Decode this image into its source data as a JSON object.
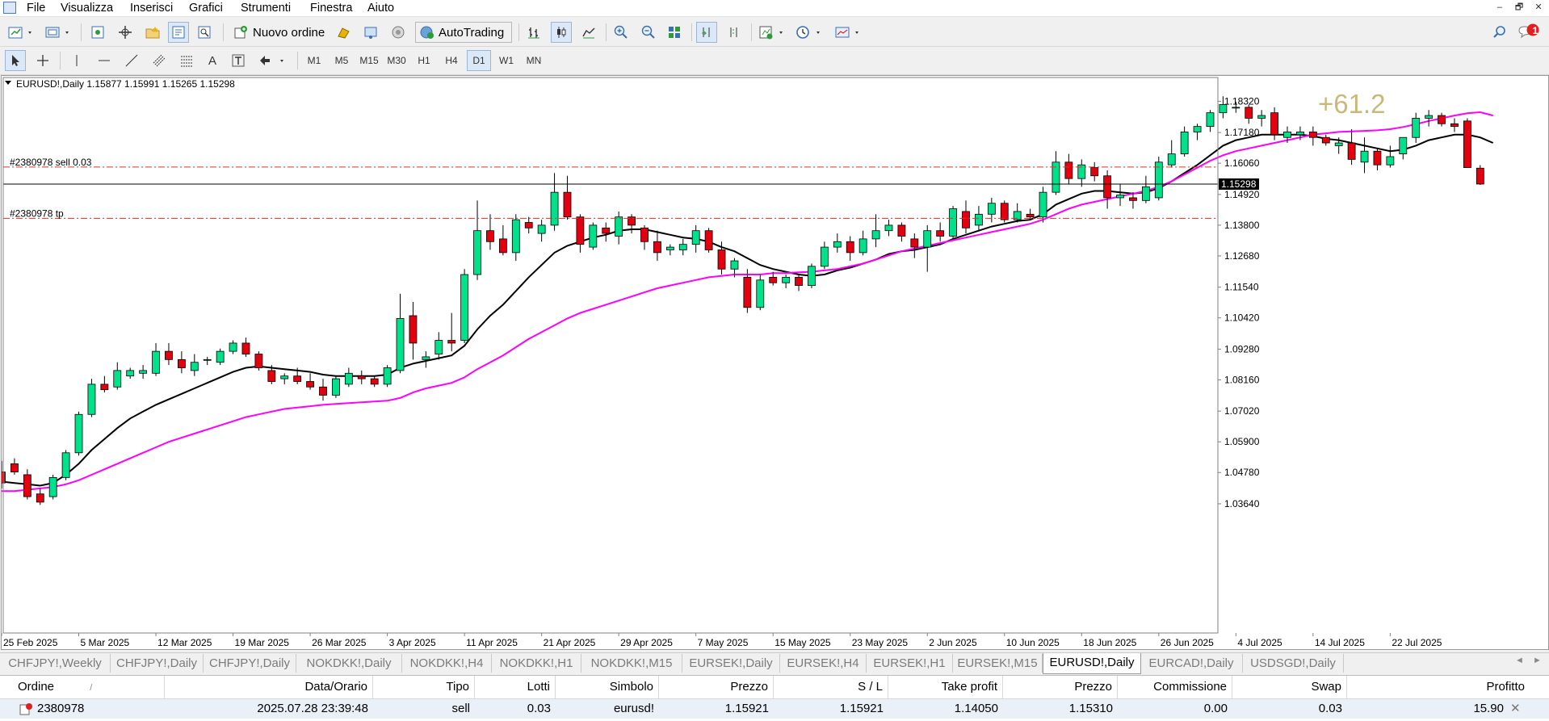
{
  "menu": [
    "File",
    "Visualizza",
    "Inserisci",
    "Grafici",
    "Strumenti",
    "Finestra",
    "Aiuto"
  ],
  "window_controls": [
    "–",
    "🗗",
    "✕"
  ],
  "toolbar": {
    "new_order_label": "Nuovo ordine",
    "autotrading_label": "AutoTrading",
    "notification_count": "1"
  },
  "timeframes": [
    "M1",
    "M5",
    "M15",
    "M30",
    "H1",
    "H4",
    "D1",
    "W1",
    "MN"
  ],
  "active_timeframe": "D1",
  "chart_header": "EURUSD!,Daily  1.15877 1.15991 1.15265 1.15298",
  "order_line_labels": {
    "sell": "#2380978 sell 0.03",
    "tp": "#2380978 tp"
  },
  "profit_overlay": "+61.2",
  "current_price_label": "1.15298",
  "chart_data": {
    "type": "candlestick",
    "symbol": "EURUSD!",
    "timeframe": "Daily",
    "ylim": [
      1.0305,
      1.1895
    ],
    "y_ticks": [
      "1.18320",
      "1.17180",
      "1.16060",
      "1.14920",
      "1.13800",
      "1.12680",
      "1.11540",
      "1.10420",
      "1.09280",
      "1.08160",
      "1.07020",
      "1.05900",
      "1.04780",
      "1.03640"
    ],
    "x_tick_labels": [
      "25 Feb 2025",
      "5 Mar 2025",
      "12 Mar 2025",
      "19 Mar 2025",
      "26 Mar 2025",
      "3 Apr 2025",
      "11 Apr 2025",
      "21 Apr 2025",
      "29 Apr 2025",
      "7 May 2025",
      "15 May 2025",
      "23 May 2025",
      "2 Jun 2025",
      "10 Jun 2025",
      "18 Jun 2025",
      "26 Jun 2025",
      "4 Jul 2025",
      "14 Jul 2025",
      "22 Jul 2025"
    ],
    "x_tick_index": [
      0,
      6,
      12,
      18,
      24,
      30,
      36,
      42,
      48,
      54,
      60,
      66,
      72,
      78,
      84,
      90,
      96,
      102,
      108
    ],
    "horizontal_lines": [
      {
        "name": "sell-entry",
        "price": 1.15921,
        "style": "dash-dot",
        "color": "#e0302a"
      },
      {
        "name": "take-profit",
        "price": 1.1405,
        "style": "dash-dot",
        "color": "#e0302a"
      },
      {
        "name": "current-bid",
        "price": 1.15298,
        "style": "solid",
        "color": "#000000"
      }
    ],
    "candles_ohlc": [
      [
        1.048,
        1.052,
        1.042,
        1.044
      ],
      [
        1.051,
        1.053,
        1.047,
        1.048
      ],
      [
        1.047,
        1.049,
        1.038,
        1.039
      ],
      [
        1.04,
        1.042,
        1.036,
        1.037
      ],
      [
        1.039,
        1.047,
        1.038,
        1.046
      ],
      [
        1.046,
        1.056,
        1.045,
        1.055
      ],
      [
        1.055,
        1.07,
        1.054,
        1.069
      ],
      [
        1.069,
        1.082,
        1.068,
        1.08
      ],
      [
        1.08,
        1.083,
        1.077,
        1.078
      ],
      [
        1.079,
        1.088,
        1.078,
        1.085
      ],
      [
        1.083,
        1.086,
        1.082,
        1.085
      ],
      [
        1.084,
        1.087,
        1.082,
        1.085
      ],
      [
        1.084,
        1.095,
        1.083,
        1.092
      ],
      [
        1.092,
        1.095,
        1.087,
        1.089
      ],
      [
        1.089,
        1.092,
        1.084,
        1.086
      ],
      [
        1.085,
        1.091,
        1.083,
        1.088
      ],
      [
        1.089,
        1.09,
        1.087,
        1.089
      ],
      [
        1.088,
        1.093,
        1.087,
        1.092
      ],
      [
        1.092,
        1.096,
        1.091,
        1.095
      ],
      [
        1.095,
        1.097,
        1.09,
        1.091
      ],
      [
        1.091,
        1.092,
        1.085,
        1.086
      ],
      [
        1.085,
        1.087,
        1.08,
        1.081
      ],
      [
        1.082,
        1.084,
        1.08,
        1.083
      ],
      [
        1.083,
        1.086,
        1.08,
        1.081
      ],
      [
        1.081,
        1.084,
        1.078,
        1.079
      ],
      [
        1.079,
        1.082,
        1.074,
        1.076
      ],
      [
        1.076,
        1.083,
        1.075,
        1.082
      ],
      [
        1.08,
        1.086,
        1.079,
        1.084
      ],
      [
        1.083,
        1.085,
        1.08,
        1.082
      ],
      [
        1.082,
        1.083,
        1.079,
        1.08
      ],
      [
        1.08,
        1.087,
        1.079,
        1.086
      ],
      [
        1.085,
        1.113,
        1.084,
        1.104
      ],
      [
        1.105,
        1.11,
        1.089,
        1.095
      ],
      [
        1.089,
        1.092,
        1.086,
        1.09
      ],
      [
        1.091,
        1.099,
        1.089,
        1.096
      ],
      [
        1.096,
        1.106,
        1.092,
        1.095
      ],
      [
        1.096,
        1.122,
        1.095,
        1.12
      ],
      [
        1.12,
        1.147,
        1.118,
        1.136
      ],
      [
        1.136,
        1.142,
        1.129,
        1.132
      ],
      [
        1.133,
        1.138,
        1.127,
        1.128
      ],
      [
        1.128,
        1.142,
        1.125,
        1.14
      ],
      [
        1.139,
        1.141,
        1.135,
        1.137
      ],
      [
        1.135,
        1.14,
        1.132,
        1.138
      ],
      [
        1.138,
        1.157,
        1.136,
        1.15
      ],
      [
        1.15,
        1.156,
        1.14,
        1.141
      ],
      [
        1.141,
        1.142,
        1.128,
        1.131
      ],
      [
        1.13,
        1.139,
        1.129,
        1.138
      ],
      [
        1.137,
        1.139,
        1.132,
        1.135
      ],
      [
        1.134,
        1.143,
        1.131,
        1.141
      ],
      [
        1.141,
        1.142,
        1.135,
        1.138
      ],
      [
        1.137,
        1.138,
        1.129,
        1.132
      ],
      [
        1.132,
        1.136,
        1.125,
        1.128
      ],
      [
        1.129,
        1.131,
        1.127,
        1.13
      ],
      [
        1.129,
        1.133,
        1.127,
        1.131
      ],
      [
        1.131,
        1.138,
        1.128,
        1.136
      ],
      [
        1.136,
        1.137,
        1.128,
        1.129
      ],
      [
        1.129,
        1.132,
        1.12,
        1.122
      ],
      [
        1.122,
        1.126,
        1.119,
        1.125
      ],
      [
        1.119,
        1.122,
        1.106,
        1.108
      ],
      [
        1.108,
        1.12,
        1.107,
        1.118
      ],
      [
        1.119,
        1.121,
        1.116,
        1.117
      ],
      [
        1.117,
        1.12,
        1.115,
        1.119
      ],
      [
        1.119,
        1.12,
        1.114,
        1.116
      ],
      [
        1.116,
        1.124,
        1.115,
        1.123
      ],
      [
        1.123,
        1.132,
        1.122,
        1.13
      ],
      [
        1.13,
        1.135,
        1.128,
        1.132
      ],
      [
        1.132,
        1.134,
        1.125,
        1.128
      ],
      [
        1.128,
        1.136,
        1.127,
        1.133
      ],
      [
        1.133,
        1.142,
        1.13,
        1.136
      ],
      [
        1.136,
        1.14,
        1.134,
        1.138
      ],
      [
        1.138,
        1.139,
        1.132,
        1.134
      ],
      [
        1.133,
        1.135,
        1.126,
        1.13
      ],
      [
        1.13,
        1.138,
        1.121,
        1.136
      ],
      [
        1.136,
        1.139,
        1.132,
        1.134
      ],
      [
        1.134,
        1.145,
        1.133,
        1.144
      ],
      [
        1.143,
        1.147,
        1.135,
        1.137
      ],
      [
        1.138,
        1.145,
        1.136,
        1.142
      ],
      [
        1.142,
        1.148,
        1.139,
        1.146
      ],
      [
        1.146,
        1.147,
        1.139,
        1.14
      ],
      [
        1.14,
        1.146,
        1.139,
        1.143
      ],
      [
        1.142,
        1.144,
        1.14,
        1.141
      ],
      [
        1.141,
        1.152,
        1.139,
        1.15
      ],
      [
        1.15,
        1.165,
        1.149,
        1.161
      ],
      [
        1.161,
        1.164,
        1.153,
        1.155
      ],
      [
        1.155,
        1.162,
        1.152,
        1.16
      ],
      [
        1.159,
        1.161,
        1.154,
        1.156
      ],
      [
        1.156,
        1.158,
        1.144,
        1.148
      ],
      [
        1.148,
        1.153,
        1.145,
        1.149
      ],
      [
        1.148,
        1.15,
        1.144,
        1.147
      ],
      [
        1.147,
        1.156,
        1.146,
        1.152
      ],
      [
        1.148,
        1.163,
        1.147,
        1.161
      ],
      [
        1.16,
        1.169,
        1.159,
        1.164
      ],
      [
        1.164,
        1.174,
        1.163,
        1.172
      ],
      [
        1.172,
        1.175,
        1.169,
        1.174
      ],
      [
        1.174,
        1.18,
        1.172,
        1.179
      ],
      [
        1.179,
        1.185,
        1.177,
        1.182
      ],
      [
        1.181,
        1.183,
        1.179,
        1.181
      ],
      [
        1.181,
        1.182,
        1.175,
        1.177
      ],
      [
        1.177,
        1.18,
        1.174,
        1.178
      ],
      [
        1.179,
        1.181,
        1.169,
        1.171
      ],
      [
        1.17,
        1.174,
        1.168,
        1.172
      ],
      [
        1.171,
        1.174,
        1.169,
        1.172
      ],
      [
        1.172,
        1.174,
        1.167,
        1.17
      ],
      [
        1.17,
        1.171,
        1.167,
        1.168
      ],
      [
        1.167,
        1.17,
        1.164,
        1.168
      ],
      [
        1.168,
        1.173,
        1.16,
        1.162
      ],
      [
        1.161,
        1.17,
        1.157,
        1.165
      ],
      [
        1.165,
        1.166,
        1.158,
        1.16
      ],
      [
        1.16,
        1.167,
        1.159,
        1.163
      ],
      [
        1.164,
        1.17,
        1.162,
        1.17
      ],
      [
        1.17,
        1.179,
        1.168,
        1.177
      ],
      [
        1.177,
        1.18,
        1.174,
        1.178
      ],
      [
        1.178,
        1.179,
        1.174,
        1.175
      ],
      [
        1.175,
        1.177,
        1.172,
        1.174
      ],
      [
        1.176,
        1.177,
        1.159,
        1.159
      ],
      [
        1.1588,
        1.1599,
        1.1527,
        1.153
      ]
    ],
    "series": [
      {
        "kind": "moving-average",
        "color": "#000000",
        "values": [
          1.0445,
          1.044,
          1.0435,
          1.043,
          1.044,
          1.047,
          1.051,
          1.056,
          1.06,
          1.064,
          1.0675,
          1.07,
          1.0725,
          1.0745,
          1.0765,
          1.0785,
          1.0805,
          1.0825,
          1.0845,
          1.086,
          1.0865,
          1.086,
          1.0855,
          1.085,
          1.0845,
          1.0835,
          1.083,
          1.083,
          1.083,
          1.083,
          1.0835,
          1.086,
          1.0875,
          1.0885,
          1.0895,
          1.0905,
          1.094,
          1.1,
          1.105,
          1.109,
          1.114,
          1.119,
          1.1235,
          1.128,
          1.1305,
          1.132,
          1.1335,
          1.1345,
          1.136,
          1.1365,
          1.1365,
          1.1355,
          1.1345,
          1.1335,
          1.133,
          1.132,
          1.13,
          1.1285,
          1.126,
          1.1235,
          1.122,
          1.121,
          1.12,
          1.1195,
          1.12,
          1.1215,
          1.1225,
          1.124,
          1.1255,
          1.1275,
          1.1285,
          1.129,
          1.13,
          1.131,
          1.133,
          1.1345,
          1.136,
          1.1375,
          1.1385,
          1.1395,
          1.14,
          1.142,
          1.1455,
          1.1475,
          1.1495,
          1.1505,
          1.1505,
          1.15,
          1.1495,
          1.15,
          1.1515,
          1.154,
          1.157,
          1.16,
          1.1635,
          1.167,
          1.169,
          1.17,
          1.171,
          1.171,
          1.171,
          1.171,
          1.1705,
          1.1695,
          1.169,
          1.168,
          1.167,
          1.166,
          1.165,
          1.1655,
          1.167,
          1.169,
          1.17,
          1.171,
          1.171,
          1.17,
          1.168
        ]
      },
      {
        "kind": "moving-average",
        "color": "#ff00ff",
        "values": [
          1.041,
          1.041,
          1.0415,
          1.042,
          1.0425,
          1.0435,
          1.045,
          1.047,
          1.049,
          1.051,
          1.053,
          1.055,
          1.057,
          1.059,
          1.0605,
          1.062,
          1.0635,
          1.065,
          1.0665,
          1.068,
          1.069,
          1.07,
          1.071,
          1.0715,
          1.072,
          1.0725,
          1.0728,
          1.0731,
          1.0734,
          1.0737,
          1.074,
          1.075,
          1.077,
          1.0785,
          1.0795,
          1.0805,
          1.0825,
          1.0855,
          1.088,
          1.0905,
          1.0935,
          1.0965,
          1.099,
          1.1015,
          1.104,
          1.106,
          1.1075,
          1.109,
          1.1105,
          1.112,
          1.1135,
          1.115,
          1.116,
          1.117,
          1.118,
          1.119,
          1.1195,
          1.12,
          1.12,
          1.12,
          1.1205,
          1.1205,
          1.1208,
          1.121,
          1.1215,
          1.122,
          1.123,
          1.124,
          1.1255,
          1.127,
          1.1285,
          1.1295,
          1.1305,
          1.1315,
          1.1325,
          1.1335,
          1.1345,
          1.1355,
          1.1365,
          1.1375,
          1.1385,
          1.14,
          1.142,
          1.144,
          1.1455,
          1.1465,
          1.1475,
          1.1485,
          1.1495,
          1.1505,
          1.152,
          1.154,
          1.1565,
          1.159,
          1.1615,
          1.1635,
          1.165,
          1.166,
          1.167,
          1.168,
          1.169,
          1.17,
          1.171,
          1.1715,
          1.172,
          1.1722,
          1.1724,
          1.1726,
          1.173,
          1.1738,
          1.1748,
          1.176,
          1.177,
          1.178,
          1.1788,
          1.1792,
          1.178
        ]
      }
    ]
  },
  "chart_tabs": [
    "CHFJPY!,Weekly",
    "CHFJPY!,Daily",
    "CHFJPY!,Daily",
    "NOKDKK!,Daily",
    "NOKDKK!,H4",
    "NOKDKK!,H1",
    "NOKDKK!,M15",
    "EURSEK!,Daily",
    "EURSEK!,H4",
    "EURSEK!,H1",
    "EURSEK!,M15",
    "EURUSD!,Daily",
    "EURCAD!,Daily",
    "USDSGD!,Daily"
  ],
  "active_tab_index": 11,
  "terminal": {
    "columns": [
      "Ordine",
      "Data/Orario",
      "Tipo",
      "Lotti",
      "Simbolo",
      "Prezzo",
      "S / L",
      "Take profit",
      "Prezzo",
      "Commissione",
      "Swap",
      "Profitto"
    ],
    "sort_indicator": "/",
    "row": [
      "2380978",
      "2025.07.28 23:39:48",
      "sell",
      "0.03",
      "eurusd!",
      "1.15921",
      "1.15921",
      "1.14050",
      "1.15310",
      "0.00",
      "0.03",
      "15.90"
    ],
    "close_glyph": "✕"
  },
  "colors": {
    "bull": "#00e18c",
    "bear": "#e3000f",
    "profit_text": "#c8b87a",
    "order_line": "#e0302a"
  }
}
